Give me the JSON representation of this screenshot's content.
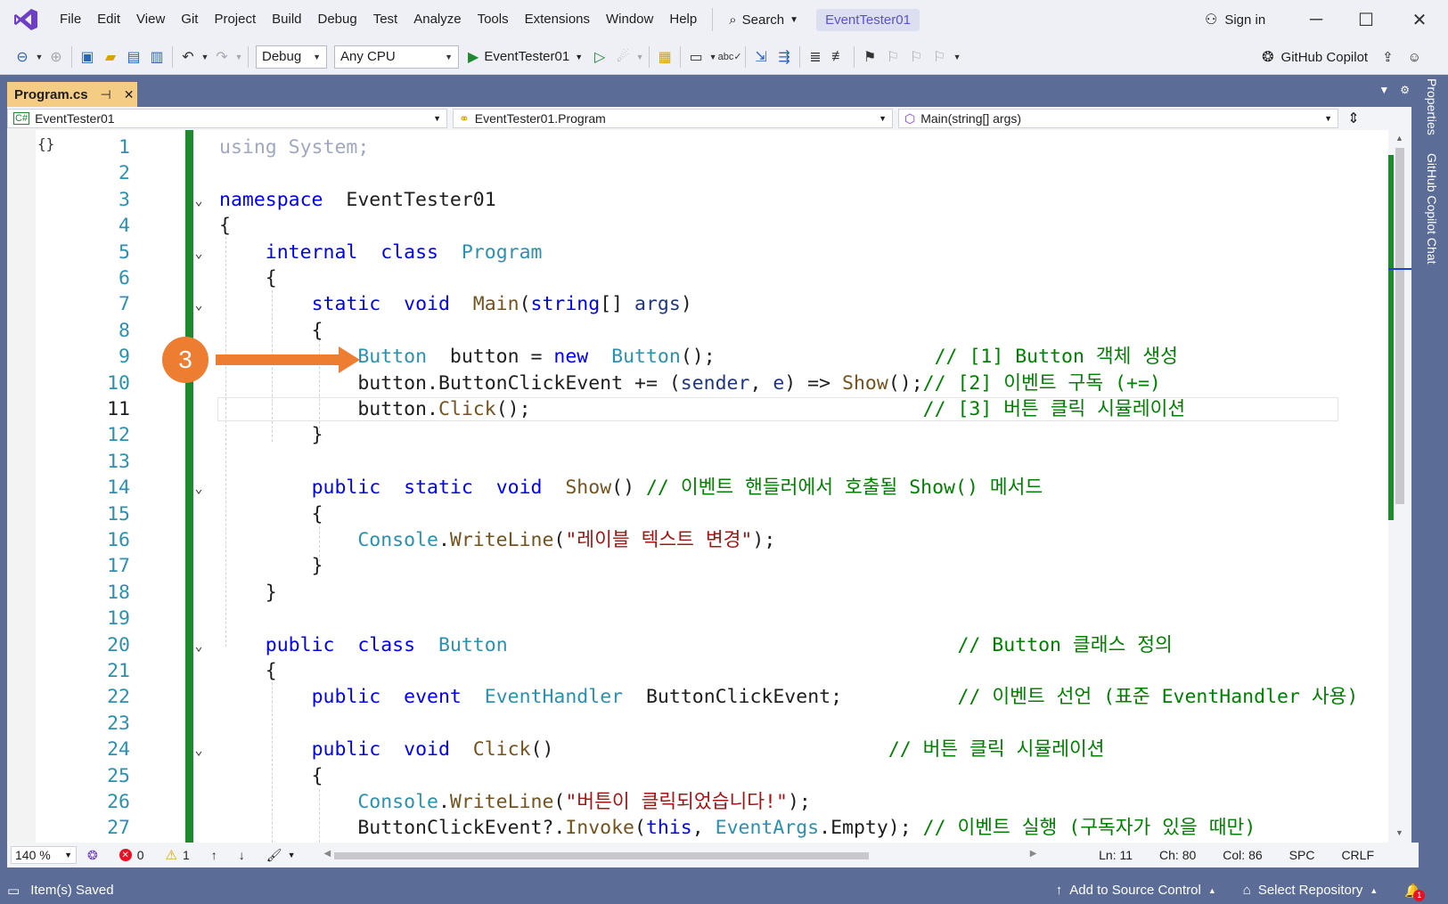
{
  "menu": {
    "items": [
      "File",
      "Edit",
      "View",
      "Git",
      "Project",
      "Build",
      "Debug",
      "Test",
      "Analyze",
      "Tools",
      "Extensions",
      "Window",
      "Help"
    ],
    "search_label": "Search",
    "solution_title": "EventTester01",
    "sign_in": "Sign in"
  },
  "toolbar": {
    "config": "Debug",
    "platform": "Any CPU",
    "run_target": "EventTester01",
    "copilot_label": "GitHub Copilot"
  },
  "tab": {
    "filename": "Program.cs",
    "pin": "⊣",
    "close": "✕"
  },
  "navbar": {
    "project": "EventTester01",
    "type": "EventTester01.Program",
    "member": "Main(string[] args)"
  },
  "side_panels": [
    "Properties",
    "GitHub Copilot Chat"
  ],
  "annotation": {
    "step_number": "3",
    "color": "#ed7d31"
  },
  "editor": {
    "current_line": 11,
    "lines": [
      {
        "n": "1",
        "fold": "",
        "tokens": [
          [
            "dim",
            "using System;"
          ]
        ]
      },
      {
        "n": "2",
        "fold": "",
        "tokens": []
      },
      {
        "n": "3",
        "fold": "v",
        "tokens": [
          [
            "kw",
            "namespace"
          ],
          [
            "",
            "  EventTester01"
          ]
        ]
      },
      {
        "n": "4",
        "fold": "",
        "tokens": [
          [
            "",
            "{"
          ]
        ]
      },
      {
        "n": "5",
        "fold": "v",
        "tokens": [
          [
            "",
            "    "
          ],
          [
            "kw",
            "internal"
          ],
          [
            "",
            "  "
          ],
          [
            "kw",
            "class"
          ],
          [
            "",
            "  "
          ],
          [
            "ty",
            "Program"
          ]
        ]
      },
      {
        "n": "6",
        "fold": "",
        "tokens": [
          [
            "",
            "    {"
          ]
        ]
      },
      {
        "n": "7",
        "fold": "v",
        "tokens": [
          [
            "",
            "        "
          ],
          [
            "kw",
            "static"
          ],
          [
            "",
            "  "
          ],
          [
            "kw",
            "void"
          ],
          [
            "",
            "  "
          ],
          [
            "me",
            "Main"
          ],
          [
            "",
            "("
          ],
          [
            "kw",
            "string"
          ],
          [
            "",
            "[] "
          ],
          [
            "pa",
            "args"
          ],
          [
            "",
            ")"
          ]
        ]
      },
      {
        "n": "8",
        "fold": "",
        "tokens": [
          [
            "",
            "        {"
          ]
        ]
      },
      {
        "n": "9",
        "fold": "",
        "tokens": [
          [
            "",
            "            "
          ],
          [
            "ty",
            "Button"
          ],
          [
            "",
            "  button = "
          ],
          [
            "kw",
            "new"
          ],
          [
            "",
            "  "
          ],
          [
            "ty",
            "Button"
          ],
          [
            "",
            "();"
          ],
          [
            "",
            "                   "
          ],
          [
            "cm",
            "// [1] Button 객체 생성"
          ]
        ]
      },
      {
        "n": "10",
        "fold": "",
        "tokens": [
          [
            "",
            "            button."
          ],
          [
            "",
            "ButtonClickEvent += ("
          ],
          [
            "pa",
            "sender"
          ],
          [
            "",
            ", "
          ],
          [
            "pa",
            "e"
          ],
          [
            "",
            ") => "
          ],
          [
            "me",
            "Show"
          ],
          [
            "",
            "();"
          ],
          [
            "cm",
            "// [2] 이벤트 구독 (+=)"
          ]
        ]
      },
      {
        "n": "11",
        "fold": "",
        "tokens": [
          [
            "",
            "            button."
          ],
          [
            "me",
            "Click"
          ],
          [
            "",
            "();"
          ],
          [
            "",
            "                                  "
          ],
          [
            "cm",
            "// [3] 버튼 클릭 시뮬레이션"
          ]
        ]
      },
      {
        "n": "12",
        "fold": "",
        "tokens": [
          [
            "",
            "        }"
          ]
        ]
      },
      {
        "n": "13",
        "fold": "",
        "tokens": []
      },
      {
        "n": "14",
        "fold": "v",
        "tokens": [
          [
            "",
            "        "
          ],
          [
            "kw",
            "public"
          ],
          [
            "",
            "  "
          ],
          [
            "kw",
            "static"
          ],
          [
            "",
            "  "
          ],
          [
            "kw",
            "void"
          ],
          [
            "",
            "  "
          ],
          [
            "me",
            "Show"
          ],
          [
            "",
            "() "
          ],
          [
            "cm",
            "// 이벤트 핸들러에서 호출될 Show() 메서드"
          ]
        ]
      },
      {
        "n": "15",
        "fold": "",
        "tokens": [
          [
            "",
            "        {"
          ]
        ]
      },
      {
        "n": "16",
        "fold": "",
        "tokens": [
          [
            "",
            "            "
          ],
          [
            "ty",
            "Console"
          ],
          [
            "",
            "."
          ],
          [
            "me",
            "WriteLine"
          ],
          [
            "",
            "("
          ],
          [
            "st",
            "\"레이블 텍스트 변경\""
          ],
          [
            "",
            ");"
          ]
        ]
      },
      {
        "n": "17",
        "fold": "",
        "tokens": [
          [
            "",
            "        }"
          ]
        ]
      },
      {
        "n": "18",
        "fold": "",
        "tokens": [
          [
            "",
            "    }"
          ]
        ]
      },
      {
        "n": "19",
        "fold": "",
        "tokens": []
      },
      {
        "n": "20",
        "fold": "v",
        "tokens": [
          [
            "",
            "    "
          ],
          [
            "kw",
            "public"
          ],
          [
            "",
            "  "
          ],
          [
            "kw",
            "class"
          ],
          [
            "",
            "  "
          ],
          [
            "ty",
            "Button"
          ],
          [
            "",
            "                                       "
          ],
          [
            "cm",
            "// Button 클래스 정의"
          ]
        ]
      },
      {
        "n": "21",
        "fold": "",
        "tokens": [
          [
            "",
            "    {"
          ]
        ]
      },
      {
        "n": "22",
        "fold": "",
        "tokens": [
          [
            "",
            "        "
          ],
          [
            "kw",
            "public"
          ],
          [
            "",
            "  "
          ],
          [
            "kw",
            "event"
          ],
          [
            "",
            "  "
          ],
          [
            "ty",
            "EventHandler"
          ],
          [
            "",
            "  ButtonClickEvent;"
          ],
          [
            "",
            "          "
          ],
          [
            "cm",
            "// 이벤트 선언 (표준 EventHandler 사용)"
          ]
        ]
      },
      {
        "n": "23",
        "fold": "",
        "tokens": []
      },
      {
        "n": "24",
        "fold": "v",
        "tokens": [
          [
            "",
            "        "
          ],
          [
            "kw",
            "public"
          ],
          [
            "",
            "  "
          ],
          [
            "kw",
            "void"
          ],
          [
            "",
            "  "
          ],
          [
            "me",
            "Click"
          ],
          [
            "",
            "()"
          ],
          [
            "",
            "                             "
          ],
          [
            "cm",
            "// 버튼 클릭 시뮬레이션"
          ]
        ]
      },
      {
        "n": "25",
        "fold": "",
        "tokens": [
          [
            "",
            "        {"
          ]
        ]
      },
      {
        "n": "26",
        "fold": "",
        "tokens": [
          [
            "",
            "            "
          ],
          [
            "ty",
            "Console"
          ],
          [
            "",
            "."
          ],
          [
            "me",
            "WriteLine"
          ],
          [
            "",
            "("
          ],
          [
            "st",
            "\"버튼이 클릭되었습니다!\""
          ],
          [
            "",
            ");"
          ]
        ]
      },
      {
        "n": "27",
        "fold": "",
        "tokens": [
          [
            "",
            "            ButtonClickEvent?."
          ],
          [
            "me",
            "Invoke"
          ],
          [
            "",
            "("
          ],
          [
            "kw",
            "this"
          ],
          [
            "",
            ", "
          ],
          [
            "ty",
            "EventArgs"
          ],
          [
            "",
            ".Empty); "
          ],
          [
            "cm",
            "// 이벤트 실행 (구독자가 있을 때만)"
          ]
        ]
      }
    ]
  },
  "editor_status": {
    "zoom": "140 %",
    "errors": "0",
    "warnings": "1",
    "ln": "Ln: 11",
    "ch": "Ch: 80",
    "col": "Col: 86",
    "spc": "SPC",
    "crlf": "CRLF"
  },
  "statusbar": {
    "message": "Item(s) Saved",
    "source_control": "Add to Source Control",
    "repository": "Select Repository",
    "notification_count": "1"
  }
}
